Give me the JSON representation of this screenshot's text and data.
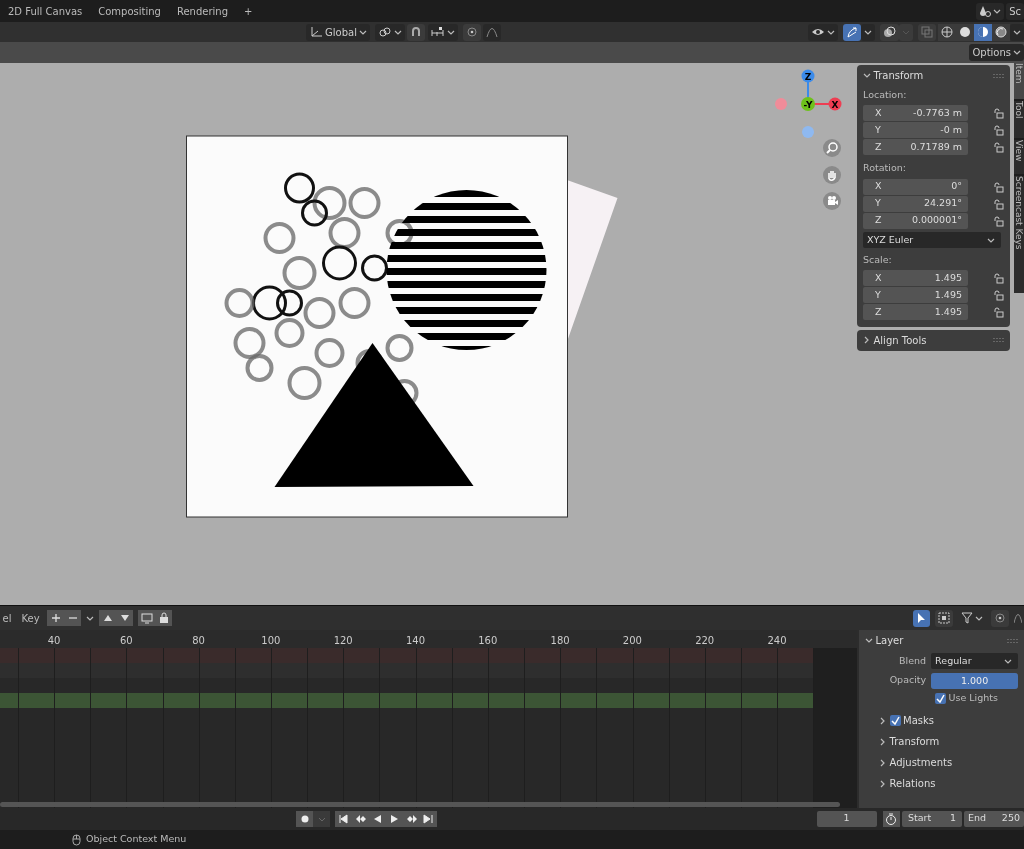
{
  "workspace_tabs": [
    {
      "label": "2D Full Canvas"
    },
    {
      "label": "Compositing"
    },
    {
      "label": "Rendering"
    }
  ],
  "add_workspace": "+",
  "scene_label": "Sc",
  "header": {
    "orientation": "Global",
    "snap_on": false,
    "proportional_on": false,
    "gizmo_on": true,
    "shading_modes": [
      {
        "kind": "wireframe",
        "selected": false
      },
      {
        "kind": "solid",
        "selected": false
      },
      {
        "kind": "material",
        "selected": true
      },
      {
        "kind": "rendered",
        "selected": false
      }
    ]
  },
  "options_label": "Options",
  "nav_gizmo": [
    {
      "label": "Z",
      "kind": "positive",
      "color": "#3b8bea"
    },
    {
      "label": "X",
      "kind": "positive",
      "color": "#ee3d52"
    },
    {
      "kind": "negative",
      "color": "#f08c99"
    },
    {
      "kind": "negative",
      "color": "#8fb9f0"
    },
    {
      "label": "-Y",
      "kind": "center",
      "color": "#6ec21b"
    }
  ],
  "sidebar": {
    "tabs": [
      {
        "label": "Item",
        "selected": true
      },
      {
        "label": "Tool",
        "selected": false
      },
      {
        "label": "View",
        "selected": false
      },
      {
        "label": "Screencast Keys",
        "selected": false
      }
    ],
    "transform": {
      "title": "Transform",
      "expanded": true,
      "groups": [
        {
          "label": "Location:",
          "fields": [
            {
              "axis": "X",
              "value": "-0.7763 m"
            },
            {
              "axis": "Y",
              "value": "-0 m"
            },
            {
              "axis": "Z",
              "value": "0.71789 m"
            }
          ]
        },
        {
          "label": "Rotation:",
          "fields": [
            {
              "axis": "X",
              "value": "0°"
            },
            {
              "axis": "Y",
              "value": "24.291°"
            },
            {
              "axis": "Z",
              "value": "0.000001°"
            }
          ],
          "mode": "XYZ Euler"
        },
        {
          "label": "Scale:",
          "fields": [
            {
              "axis": "X",
              "value": "1.495"
            },
            {
              "axis": "Y",
              "value": "1.495"
            },
            {
              "axis": "Z",
              "value": "1.495"
            }
          ]
        }
      ]
    },
    "align_tools": {
      "title": "Align Tools",
      "expanded": false
    }
  },
  "timeline": {
    "menus": [
      "el",
      "Key"
    ],
    "ruler": [
      "40",
      "60",
      "80",
      "100",
      "120",
      "140",
      "160",
      "180",
      "200",
      "220",
      "240"
    ],
    "channels": [
      {
        "color": "#3a2b2b"
      },
      {
        "color": "#2e2e2e"
      },
      {
        "color": "#282828"
      },
      {
        "color": "#3c5535"
      }
    ]
  },
  "layer_panel": {
    "title": "Layer",
    "expanded": true,
    "blend_label": "Blend",
    "blend": "Regular",
    "opacity_label": "Opacity",
    "opacity": "1.000",
    "level": 1.0,
    "use_lights": {
      "label": "Use Lights",
      "checked": true
    },
    "subpanels": [
      {
        "label": "Masks",
        "expanded": false,
        "checked": true
      },
      {
        "label": "Transform",
        "expanded": false
      },
      {
        "label": "Adjustments",
        "expanded": false
      },
      {
        "label": "Relations",
        "expanded": false
      }
    ]
  },
  "playback": {
    "current_frame": "1",
    "start_label": "Start",
    "start": "1",
    "end_label": "End",
    "end": "250"
  },
  "status_bar": {
    "hint": "Object Context Menu"
  }
}
